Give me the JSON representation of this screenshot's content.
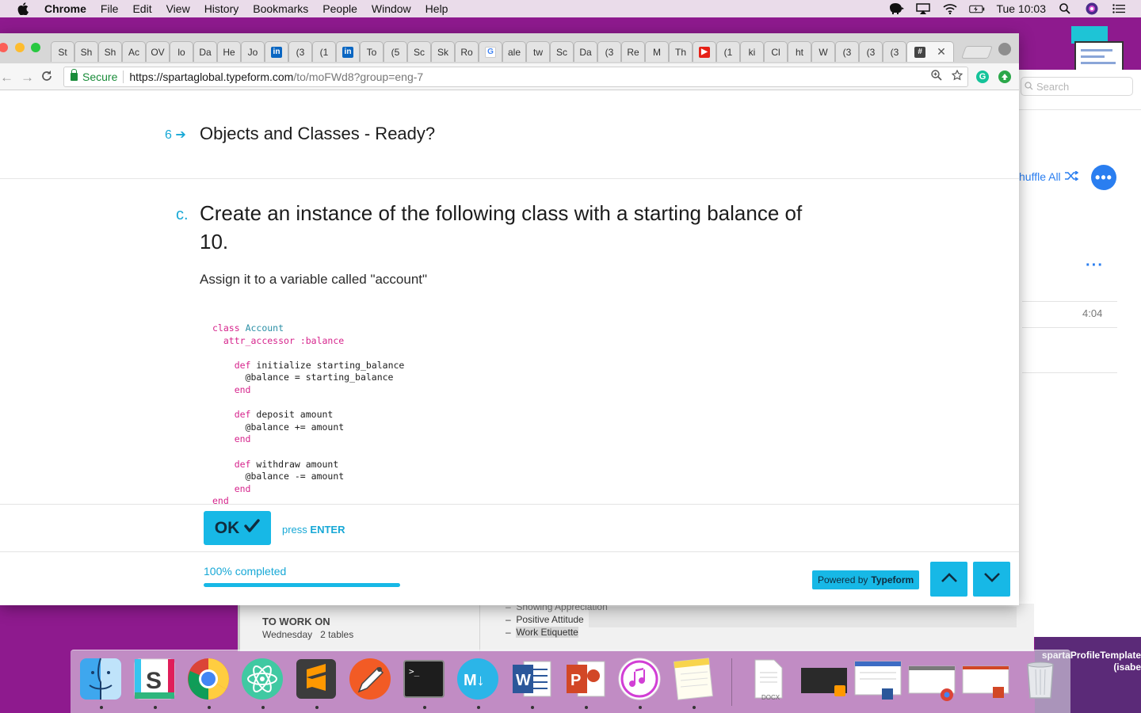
{
  "menubar": {
    "app": "Chrome",
    "items": [
      "File",
      "Edit",
      "View",
      "History",
      "Bookmarks",
      "People",
      "Window",
      "Help"
    ],
    "clock": "Tue 10:03"
  },
  "browser": {
    "tabs": [
      "St",
      "Sh",
      "Sh",
      "Ac",
      "OV",
      "lo",
      "Da",
      "He",
      "Jo",
      "in",
      "(3",
      "(1",
      "in",
      "To",
      "(5",
      "Sc",
      "Sk",
      "Ro",
      "G",
      "ale",
      "tw",
      "Sc",
      "Da",
      "(3",
      "Re",
      "M",
      "Th",
      "▶",
      "(1",
      "ki",
      "Cl",
      "ht",
      "W",
      "(3",
      "(3",
      "(3",
      "#"
    ],
    "secure_label": "Secure",
    "url_main": "https://spartaglobal.typeform.com",
    "url_rest": "/to/moFWd8?group=eng-7"
  },
  "form": {
    "prev_question_number": "6",
    "prev_question_title": "Objects and Classes - Ready?",
    "question_letter": "c.",
    "question_title": "Create an instance of the following class with a starting balance of 10.",
    "question_sub": "Assign it to a variable called \"account\"",
    "code": {
      "line1_kw": "class",
      "line1_name": "Account",
      "line2_kw": "attr_accessor",
      "line2_sym": ":balance",
      "line3_kw": "def",
      "line3_rest": "initialize starting_balance",
      "line4": "@balance = starting_balance",
      "end": "end",
      "line6_kw": "def",
      "line6_rest": "deposit amount",
      "line7": "@balance += amount",
      "line9_kw": "def",
      "line9_rest": "withdraw amount",
      "line10": "@balance -= amount"
    },
    "ok_label": "OK",
    "press_label": "press",
    "enter_label": "ENTER",
    "progress_label": "100% completed",
    "progress_percent": 100,
    "powered_label": "Powered by",
    "powered_brand": "Typeform"
  },
  "background_app": {
    "search_placeholder": "Search",
    "shuffle_label": "huffle All",
    "duration": "4:04"
  },
  "background_doc": {
    "todo_title": "TO WORK ON",
    "todo_day": "Wednesday",
    "todo_tables": "2 tables",
    "bullets": [
      "Showing Appreciation",
      "Positive Attitude",
      "Work Etiquette"
    ],
    "docx_label": "DOCX"
  },
  "desktop_label": "spartaProfileTemplate (isabe",
  "dock": {
    "apps": [
      "finder-icon",
      "slack-icon",
      "chrome-icon",
      "atom-icon",
      "sublime-text-icon",
      "scrivener-pen-icon",
      "terminal-icon",
      "markdown-icon",
      "word-icon",
      "powerpoint-icon",
      "itunes-icon",
      "notes-icon",
      "docx-file-icon",
      "sublime-doc-icon",
      "word-doc-icon",
      "chrome-doc-icon",
      "powerpoint-doc-icon",
      "trash-icon"
    ],
    "doc_label": "DOCX"
  },
  "colors": {
    "typeform_accent": "#17b8e6",
    "chrome_secure": "#1a8c3a",
    "desktop": "#8e1a8e"
  }
}
